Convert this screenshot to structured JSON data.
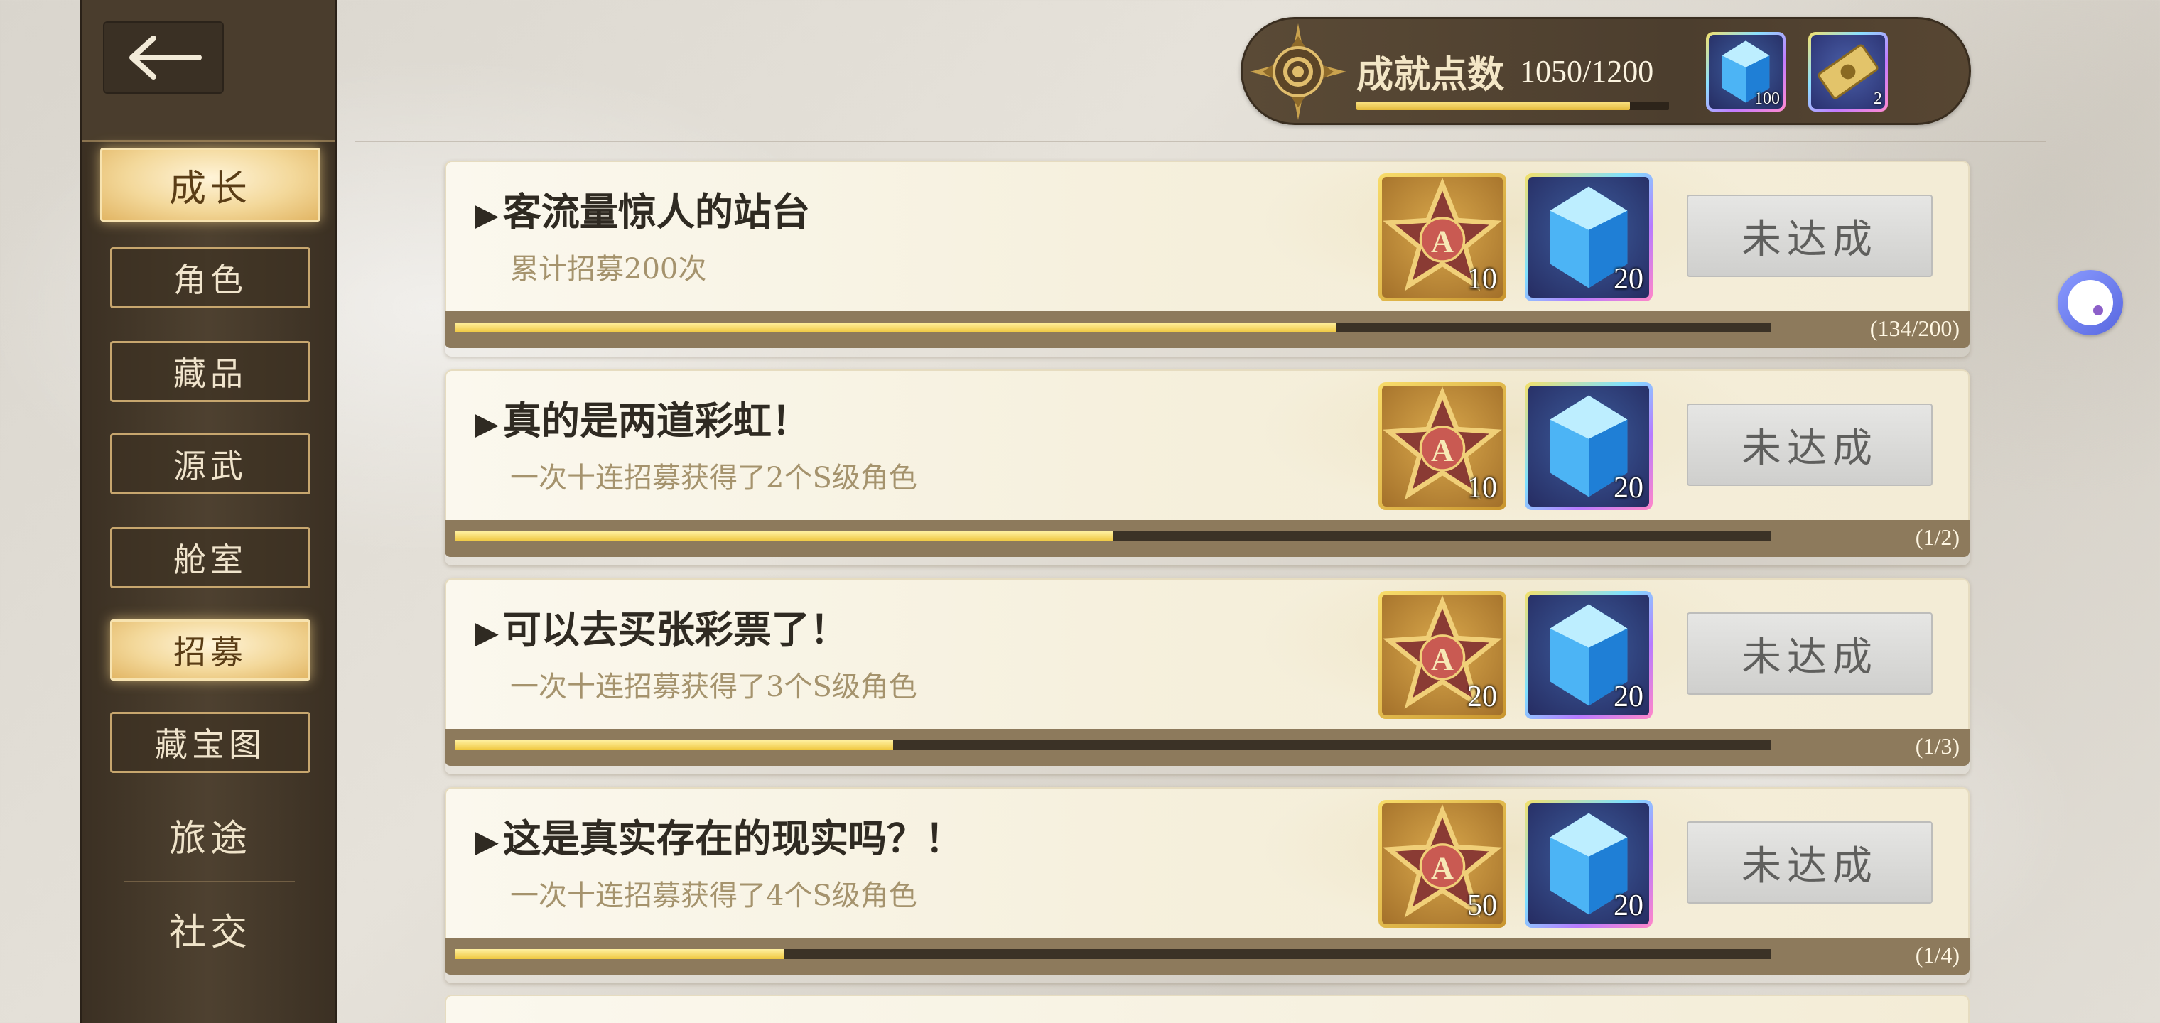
{
  "back": {
    "icon": "back-arrow-icon"
  },
  "sidebar": {
    "items": [
      {
        "label": "成长",
        "state": "active-primary"
      },
      {
        "label": "角色",
        "state": "normal"
      },
      {
        "label": "藏品",
        "state": "normal"
      },
      {
        "label": "源武",
        "state": "normal"
      },
      {
        "label": "舱室",
        "state": "normal"
      },
      {
        "label": "招募",
        "state": "active"
      },
      {
        "label": "藏宝图",
        "state": "normal"
      },
      {
        "label": "旅途",
        "state": "plain"
      },
      {
        "label": "社交",
        "state": "plain"
      }
    ]
  },
  "header": {
    "achievement_label": "成就点数",
    "achievement_value": "1050/1200",
    "achievement_progress": 0.875,
    "items": [
      {
        "icon": "blue-crystal-icon",
        "count": "100"
      },
      {
        "icon": "gold-ticket-icon",
        "count": "2"
      }
    ]
  },
  "cards": [
    {
      "title": "客流量惊人的站台",
      "desc": "累计招募200次",
      "rewards": [
        {
          "icon": "a-star-badge-icon",
          "count": "10"
        },
        {
          "icon": "blue-crystal-icon",
          "count": "20"
        }
      ],
      "status": "未达成",
      "progress": 0.67,
      "count": "(134/200)"
    },
    {
      "title": "真的是两道彩虹！",
      "desc": "一次十连招募获得了2个S级角色",
      "rewards": [
        {
          "icon": "a-star-badge-icon",
          "count": "10"
        },
        {
          "icon": "blue-crystal-icon",
          "count": "20"
        }
      ],
      "status": "未达成",
      "progress": 0.5,
      "count": "(1/2)"
    },
    {
      "title": "可以去买张彩票了！",
      "desc": "一次十连招募获得了3个S级角色",
      "rewards": [
        {
          "icon": "a-star-badge-icon",
          "count": "20"
        },
        {
          "icon": "blue-crystal-icon",
          "count": "20"
        }
      ],
      "status": "未达成",
      "progress": 0.333,
      "count": "(1/3)"
    },
    {
      "title": "这是真实存在的现实吗？！",
      "desc": "一次十连招募获得了4个S级角色",
      "rewards": [
        {
          "icon": "a-star-badge-icon",
          "count": "50"
        },
        {
          "icon": "blue-crystal-icon",
          "count": "20"
        }
      ],
      "status": "未达成",
      "progress": 0.25,
      "count": "(1/4)"
    }
  ],
  "colors": {
    "sidebar_bg": "#4e4130",
    "accent_gold": "#efc73e",
    "status_grey": "#cfcfcd"
  }
}
